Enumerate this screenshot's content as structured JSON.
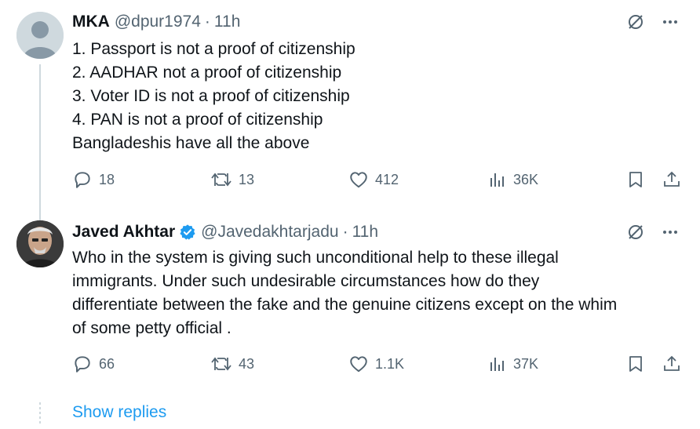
{
  "tweets": [
    {
      "name": "MKA",
      "handle": "@dpur1974",
      "separator": "·",
      "time": "11h",
      "verified": false,
      "lines": [
        "1. Passport is not a proof of citizenship",
        "2. AADHAR not a proof of citizenship",
        "3. Voter ID is not a proof of citizenship",
        "4. PAN is not a proof of citizenship",
        "Bangladeshis have all the above"
      ],
      "stats": {
        "replies": "18",
        "retweets": "13",
        "likes": "412",
        "views": "36K"
      }
    },
    {
      "name": "Javed Akhtar",
      "handle": "@Javedakhtarjadu",
      "separator": "·",
      "time": "11h",
      "verified": true,
      "lines": [
        "Who in the system is giving such unconditional help to these illegal",
        "immigrants. Under such undesirable circumstances how do they",
        "differentiate between the fake and the genuine citizens except on the whim",
        "of some petty official ."
      ],
      "stats": {
        "replies": "66",
        "retweets": "43",
        "likes": "1.1K",
        "views": "37K"
      }
    }
  ],
  "show_replies": "Show replies",
  "colors": {
    "text": "#0f1419",
    "secondary": "#536471",
    "accent": "#1d9bf0",
    "verified": "#1d9bf0"
  },
  "icons": [
    "grok-icon",
    "more-icon",
    "reply-icon",
    "retweet-icon",
    "like-icon",
    "views-icon",
    "bookmark-icon",
    "share-icon",
    "verified-badge-icon"
  ]
}
